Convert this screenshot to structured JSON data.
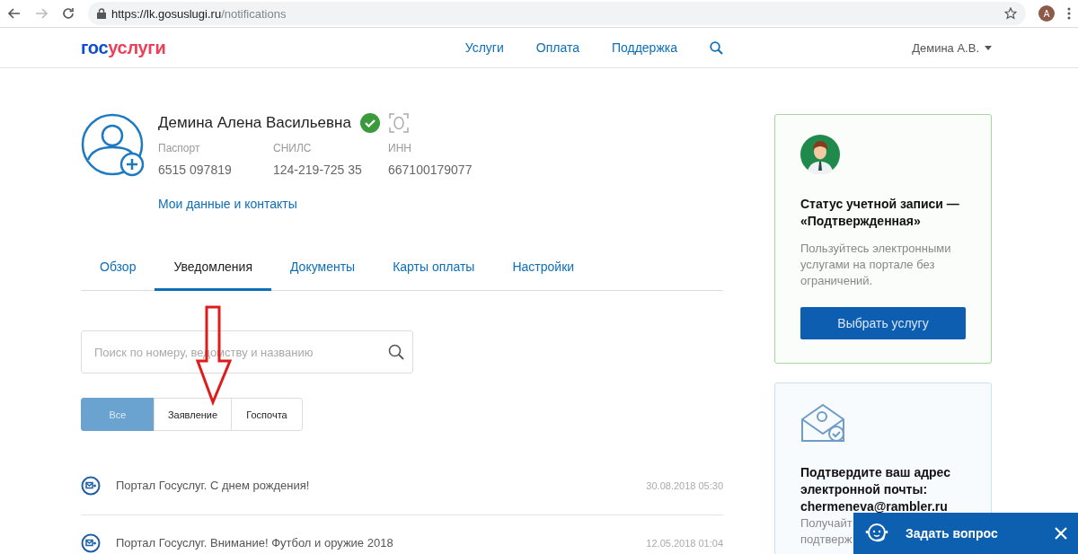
{
  "browser": {
    "url_host": "https://lk.gosuslugi.ru",
    "url_path": "/notifications",
    "profile_initial": "A"
  },
  "header": {
    "logo": [
      "гос",
      "услуги"
    ],
    "nav": [
      {
        "label": "Услуги"
      },
      {
        "label": "Оплата"
      },
      {
        "label": "Поддержка"
      }
    ],
    "user_menu": "Демина А.В."
  },
  "profile": {
    "name": "Демина Алена Васильевна",
    "verified": true,
    "fields": [
      {
        "label": "Паспорт",
        "value": "6515 097819"
      },
      {
        "label": "СНИЛС",
        "value": "124-219-725 35"
      },
      {
        "label": "ИНН",
        "value": "667100179077"
      }
    ],
    "link": "Мои данные и контакты"
  },
  "tabs": [
    {
      "label": "Обзор",
      "selected": false
    },
    {
      "label": "Уведомления",
      "selected": true
    },
    {
      "label": "Документы",
      "selected": false
    },
    {
      "label": "Карты оплаты",
      "selected": false
    },
    {
      "label": "Настройки",
      "selected": false
    }
  ],
  "search": {
    "placeholder": "Поиск по номеру, ведомству и названию"
  },
  "filters": [
    {
      "label": "Все",
      "selected": true
    },
    {
      "label": "Заявление",
      "selected": false
    },
    {
      "label": "Госпочта",
      "selected": false
    }
  ],
  "notifications": [
    {
      "title": "Портал Госуслуг. С днем рождения!",
      "date": "30.08.2018 05:30"
    },
    {
      "title": "Портал Госуслуг. Внимание! Футбол и оружие 2018",
      "date": "12.05.2018 01:04"
    }
  ],
  "status_card": {
    "title": "Статус учетной записи — «Подтвержденная»",
    "text": "Пользуйтесь электронными услугами на портале без ограничений.",
    "button": "Выбрать услугу"
  },
  "email_card": {
    "title": "Подтвердите ваш адрес электронной почты:",
    "email": "chermeneva@rambler.ru",
    "text_lines": [
      "Получайт",
      "подтверж"
    ]
  },
  "chat": {
    "label": "Задать вопрос"
  }
}
